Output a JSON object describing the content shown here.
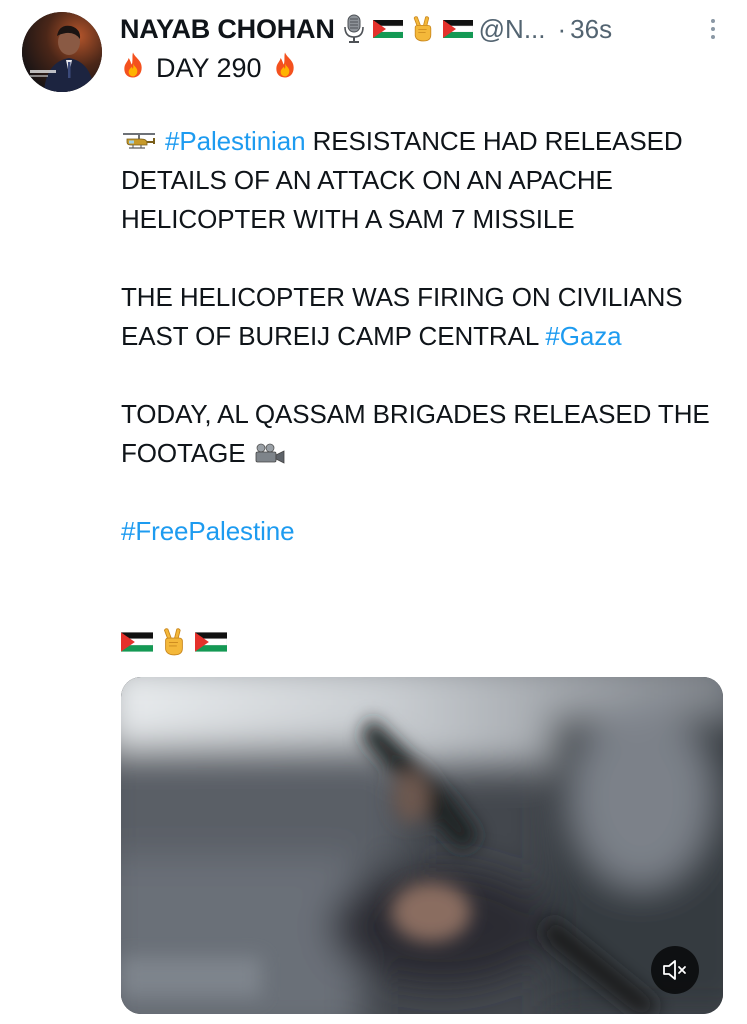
{
  "post": {
    "author_name": "NAYAB CHOHAN",
    "handle": "@N...",
    "dot": "·",
    "time": "36s",
    "day_label": "DAY 290",
    "hashtag_palestinian": "#Palestinian",
    "para1_rest": " RESISTANCE HAD RELEASED DETAILS OF AN ATTACK ON AN APACHE HELICOPTER WITH A SAM 7 MISSILE",
    "para2_text": "THE HELICOPTER WAS FIRING ON CIVILIANS EAST OF BUREIJ CAMP CENTRAL ",
    "hashtag_gaza": "#Gaza",
    "para3_text": "TODAY, AL QASSAM BRIGADES RELEASED THE FOOTAGE",
    "hashtag_freepalestine": "#FreePalestine"
  },
  "icons": {
    "header": [
      "microphone-icon",
      "palestine-flag-icon",
      "victory-hand-icon",
      "palestine-flag-icon"
    ],
    "day_line": [
      "fire-icon",
      "fire-icon"
    ],
    "para1": "helicopter-icon",
    "para3": "video-camera-icon",
    "flags_row": [
      "palestine-flag-icon",
      "victory-hand-icon",
      "palestine-flag-icon"
    ],
    "media": "volume-muted-icon"
  },
  "colors": {
    "link": "#1d9bf0",
    "secondary_text": "#536471",
    "flag_green": "#149954",
    "flag_red": "#e4312b"
  }
}
